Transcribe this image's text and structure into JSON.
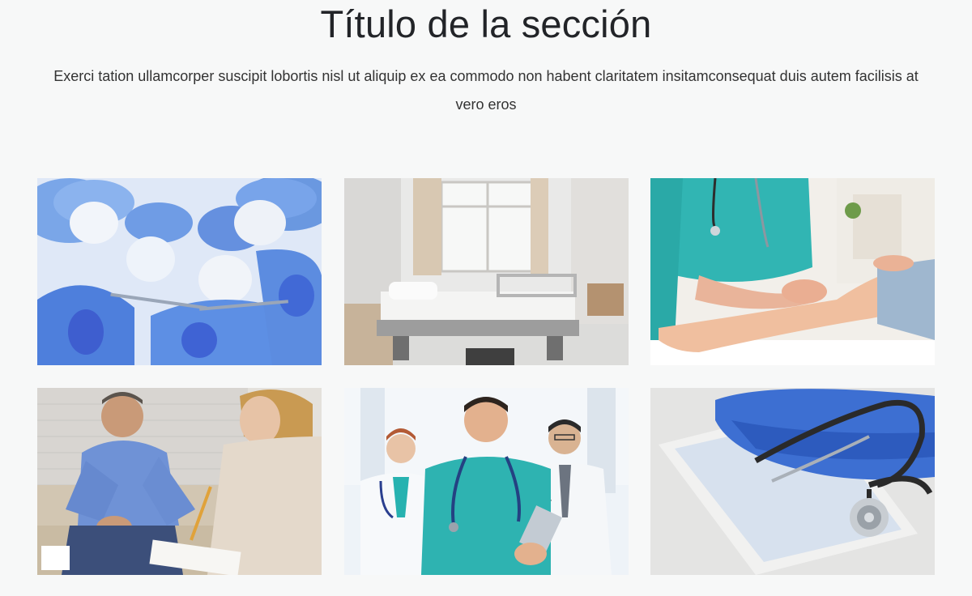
{
  "section": {
    "title": "Título de la sección",
    "description": "Exerci tation ullamcorper suscipit lobortis nisl ut aliquip ex ea commodo non habent claritatem insitamconsequat duis autem facilisis at vero eros"
  },
  "gallery": {
    "images": [
      {
        "subject": "surgeons-in-blue-scrubs"
      },
      {
        "subject": "hospital-room-bed"
      },
      {
        "subject": "nurse-examining-leg"
      },
      {
        "subject": "patient-counseling-session"
      },
      {
        "subject": "medical-team-portrait"
      },
      {
        "subject": "stethoscope-on-tablet"
      }
    ]
  },
  "colors": {
    "background": "#f7f8f8",
    "title": "#222428",
    "scrub_blue": "#5b86e0",
    "teal_scrub": "#2fb9b4"
  }
}
